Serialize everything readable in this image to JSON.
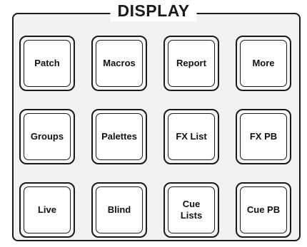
{
  "panel": {
    "title": "DISPLAY",
    "keys": [
      {
        "id": "patch",
        "label": "Patch"
      },
      {
        "id": "macros",
        "label": "Macros"
      },
      {
        "id": "report",
        "label": "Report"
      },
      {
        "id": "more",
        "label": "More"
      },
      {
        "id": "groups",
        "label": "Groups"
      },
      {
        "id": "palettes",
        "label": "Palettes"
      },
      {
        "id": "fx-list",
        "label": "FX List"
      },
      {
        "id": "fx-pb",
        "label": "FX PB"
      },
      {
        "id": "live",
        "label": "Live"
      },
      {
        "id": "blind",
        "label": "Blind"
      },
      {
        "id": "cue-lists",
        "label": "Cue\nLists"
      },
      {
        "id": "cue-pb",
        "label": "Cue PB"
      }
    ]
  }
}
